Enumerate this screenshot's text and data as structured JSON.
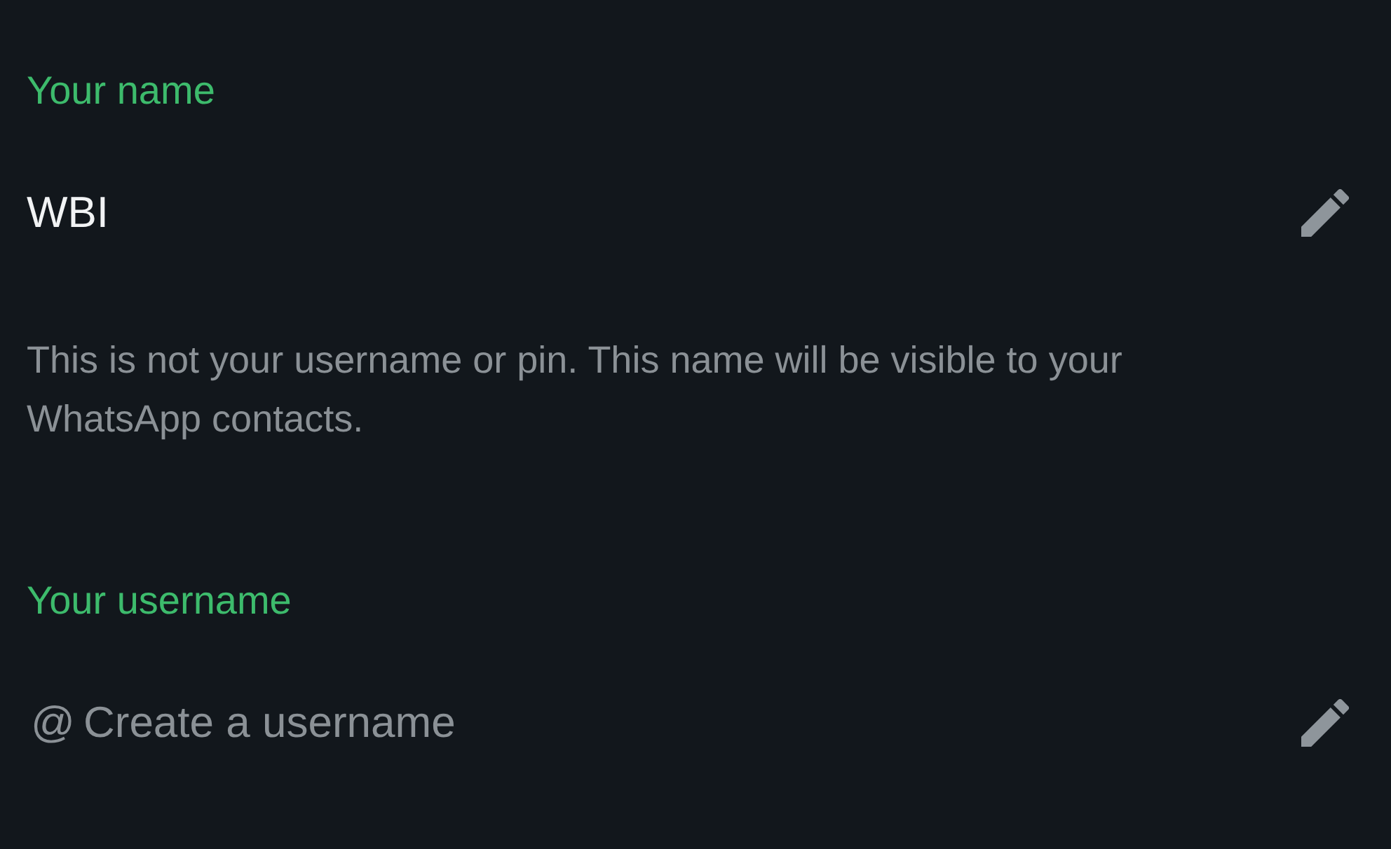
{
  "name_section": {
    "label": "Your name",
    "value": "WBI",
    "note": "This is not your username or pin. This name will be visible to your WhatsApp contacts."
  },
  "username_section": {
    "label": "Your username",
    "prefix": "@",
    "placeholder": "Create a username"
  }
}
